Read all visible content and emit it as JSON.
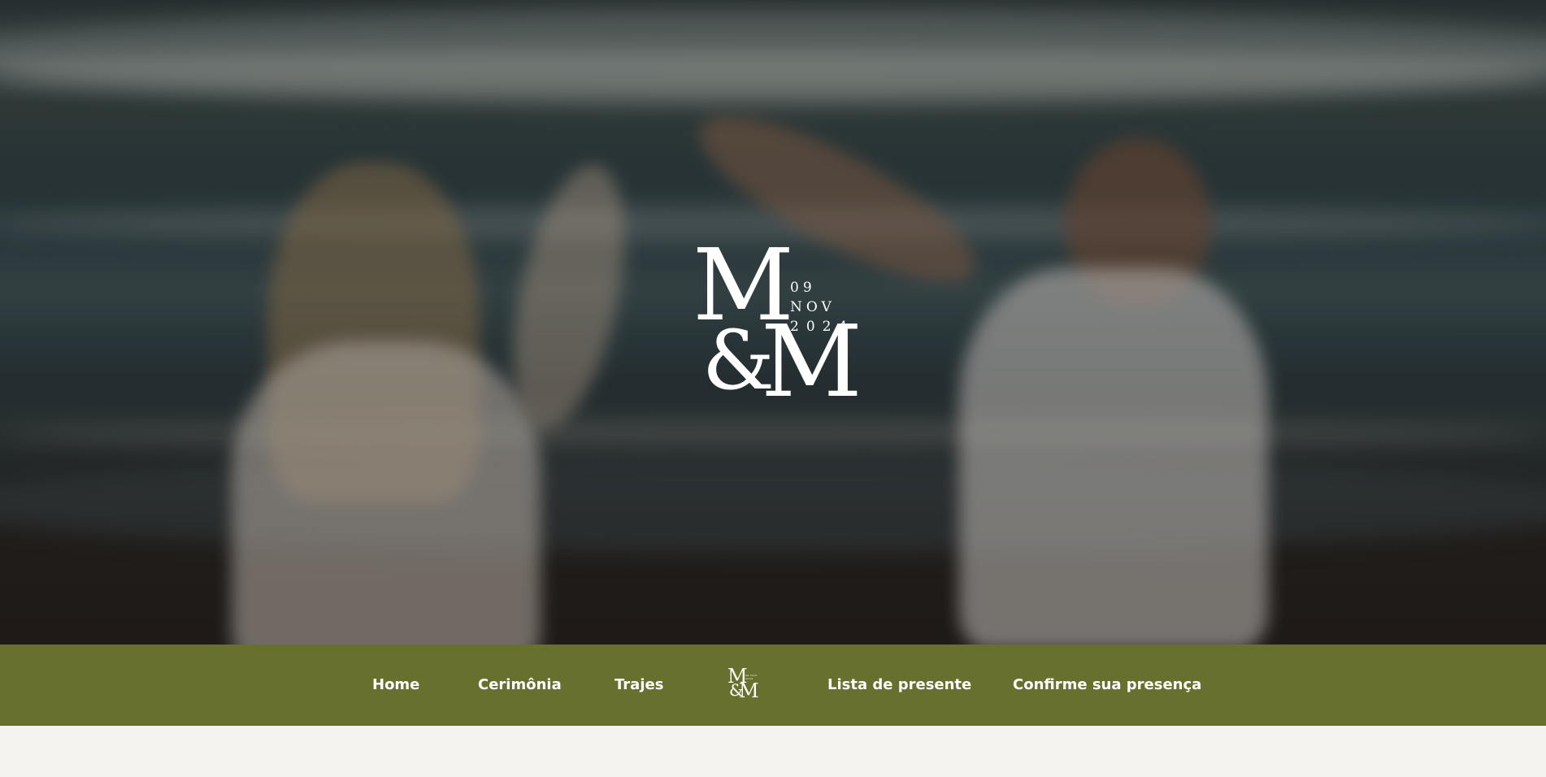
{
  "hero": {
    "image_description_icon": "beach-couple-photo",
    "logo": {
      "initial_1": "M",
      "ampersand": "&",
      "initial_2": "M",
      "date_line_1": "09 NOV",
      "date_line_2": "2024"
    }
  },
  "nav": {
    "background_color": "#68702d",
    "items": [
      {
        "label": "Home"
      },
      {
        "label": "Cerimônia"
      },
      {
        "label": "Trajes"
      },
      {
        "label": "Lista de presente"
      },
      {
        "label": "Confirme sua presença"
      }
    ],
    "logo": {
      "initial_1": "M",
      "ampersand": "&",
      "initial_2": "M",
      "date_line_1": "09 NOV",
      "date_line_2": "2024"
    }
  },
  "colors": {
    "page_background": "#f4f3ef",
    "nav_text": "#ffffff"
  }
}
